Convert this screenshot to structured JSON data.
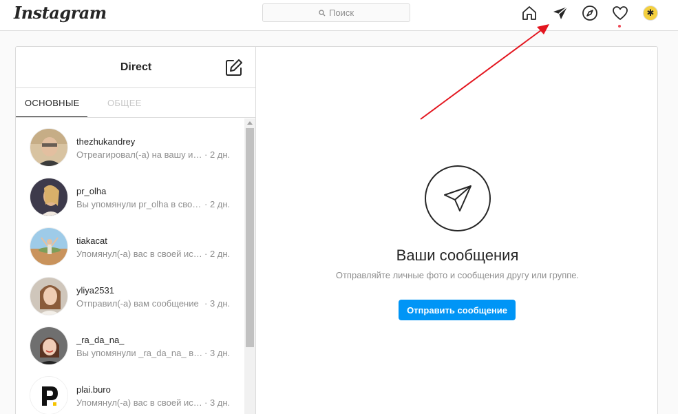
{
  "app": {
    "logo": "Instagram"
  },
  "search": {
    "placeholder": "Поиск"
  },
  "nav": {
    "icons": [
      "home-icon",
      "direct-icon",
      "explore-icon",
      "activity-icon",
      "profile-avatar"
    ]
  },
  "inbox": {
    "title": "Direct",
    "tabs": [
      {
        "label": "ОСНОВНЫЕ",
        "active": true
      },
      {
        "label": "ОБЩЕЕ",
        "active": false
      }
    ],
    "threads": [
      {
        "name": "thezhukandrey",
        "message": "Отреагировал(-а) на вашу историю",
        "time": "· 2 дн."
      },
      {
        "name": "pr_olha",
        "message": "Вы упомянули pr_olha в своей истории",
        "time": "· 2 дн."
      },
      {
        "name": "tiakacat",
        "message": "Упомянул(-а) вас в своей истории",
        "time": "· 2 дн."
      },
      {
        "name": "yliya2531",
        "message": "Отправил(-а) вам сообщение",
        "time": "· 3 дн."
      },
      {
        "name": "_ra_da_na_",
        "message": "Вы упомянули _ra_da_na_ в своей истории",
        "time": "· 3 дн."
      },
      {
        "name": "plai.buro",
        "message": "Упомянул(-а) вас в своей истории",
        "time": "· 3 дн."
      }
    ]
  },
  "empty_state": {
    "title": "Ваши сообщения",
    "subtitle": "Отправляйте личные фото и сообщения другу или группе.",
    "button": "Отправить сообщение"
  },
  "colors": {
    "accent": "#0095f6",
    "border": "#dbdbdb",
    "annotation_arrow": "#e3161f",
    "notification_dot": "#ed4956"
  }
}
